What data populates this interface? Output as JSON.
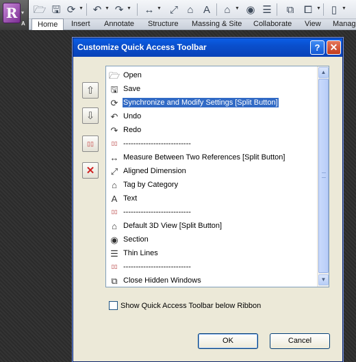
{
  "app": {
    "logo_letter": "R",
    "logo_sub": "A",
    "dropdown_arrow": "▾"
  },
  "qat_icons": [
    "open-icon",
    "save-icon",
    "synchronize-icon",
    "undo-icon",
    "redo-icon",
    "measure-icon",
    "aligned-dimension-icon",
    "tag-icon",
    "text-icon",
    "3d-view-icon",
    "section-icon",
    "close-hidden-windows-icon",
    "switch-windows-icon",
    "qat-customize-icon"
  ],
  "ribbon_tabs": [
    "Home",
    "Insert",
    "Annotate",
    "Structure",
    "Massing & Site",
    "Collaborate",
    "View",
    "Manag"
  ],
  "dialog": {
    "title": "Customize Quick Access Toolbar",
    "help_label": "?",
    "close_label": "✕",
    "items": [
      {
        "label": "Open",
        "icon": "open-icon",
        "glyph": "🗁"
      },
      {
        "label": "Save",
        "icon": "save-icon",
        "glyph": "🖫"
      },
      {
        "label": "Synchronize and Modify Settings [Split Button]",
        "icon": "synchronize-icon",
        "glyph": "⟳",
        "selected": true
      },
      {
        "label": "Undo",
        "icon": "undo-icon",
        "glyph": "↶"
      },
      {
        "label": "Redo",
        "icon": "redo-icon",
        "glyph": "↷"
      },
      {
        "label": "---------------------------",
        "icon": "separator-icon",
        "glyph": "▯▯"
      },
      {
        "label": "Measure Between Two References [Split Button]",
        "icon": "measure-icon",
        "glyph": "↔"
      },
      {
        "label": "Aligned Dimension",
        "icon": "aligned-dimension-icon",
        "glyph": "⤢"
      },
      {
        "label": "Tag by Category",
        "icon": "tag-icon",
        "glyph": "⌂"
      },
      {
        "label": "Text",
        "icon": "text-icon",
        "glyph": "A"
      },
      {
        "label": "---------------------------",
        "icon": "separator-icon",
        "glyph": "▯▯"
      },
      {
        "label": "Default 3D View [Split Button]",
        "icon": "3d-view-icon",
        "glyph": "⌂"
      },
      {
        "label": "Section",
        "icon": "section-icon",
        "glyph": "◉"
      },
      {
        "label": "Thin Lines",
        "icon": "thin-lines-icon",
        "glyph": "☰"
      },
      {
        "label": "---------------------------",
        "icon": "separator-icon",
        "glyph": "▯▯"
      },
      {
        "label": "Close Hidden Windows",
        "icon": "close-hidden-windows-icon",
        "glyph": "⧉"
      }
    ],
    "side_buttons": [
      {
        "name": "move-up-button",
        "icon": "arrow-up-icon",
        "glyph": "⇧"
      },
      {
        "name": "move-down-button",
        "icon": "arrow-down-icon",
        "glyph": "⇩"
      },
      {
        "name": "add-separator-button",
        "icon": "separator-icon",
        "glyph": "▯▯"
      },
      {
        "name": "remove-button",
        "icon": "delete-icon",
        "glyph": "✕"
      }
    ],
    "checkbox_label": "Show Quick Access Toolbar below Ribbon",
    "ok_label": "OK",
    "cancel_label": "Cancel"
  }
}
